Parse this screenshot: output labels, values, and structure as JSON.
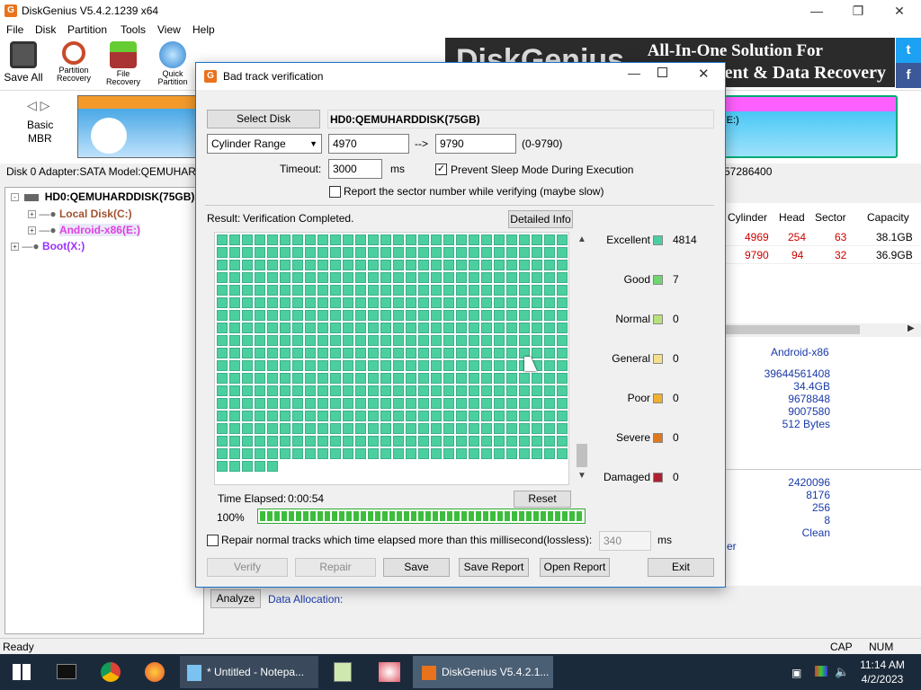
{
  "app": {
    "title": "DiskGenius V5.4.2.1239 x64",
    "menu": [
      "File",
      "Disk",
      "Partition",
      "Tools",
      "View",
      "Help"
    ],
    "toolbar": [
      "Save All",
      "Partition Recovery",
      "File Recovery",
      "Quick Partition"
    ],
    "banner_line1": "All-In-One Solution For",
    "banner_line2": "ement & Data Recovery",
    "banner_logo": "DiskGenius",
    "social": [
      "t",
      "f"
    ]
  },
  "disk_area": {
    "nav": "Basic",
    "nav2": "MBR",
    "right_label1": "(E:)",
    "right_label2": ")",
    "info": "Disk 0 Adapter:SATA  Model:QEMUHARD",
    "info_right": "57286400"
  },
  "tree": {
    "disk": "HD0:QEMUHARDDISK(75GB)",
    "items": [
      {
        "label": "Local Disk(C:)",
        "color": "#8b4513"
      },
      {
        "label": "Android-x86(E:)",
        "color": "#e040e0"
      },
      {
        "label": "Boot(X:)",
        "color": "#9b30ff"
      }
    ]
  },
  "ptable": {
    "headers": [
      "Cylinder",
      "Head",
      "Sector",
      "Capacity"
    ],
    "rows": [
      [
        "4969",
        "254",
        "63",
        "38.1GB"
      ],
      [
        "9790",
        "94",
        "32",
        "36.9GB"
      ]
    ]
  },
  "pinfo": {
    "name": "Android-x86",
    "values1": [
      "39644561408",
      "34.4GB",
      "9678848",
      "9007580",
      "512 Bytes"
    ],
    "values2": [
      "2420096",
      "8176",
      "256",
      "8",
      "Clean"
    ],
    "frag": "er"
  },
  "bottom": {
    "analyze": "Analyze",
    "data_allocation": "Data Allocation:"
  },
  "status": {
    "ready": "Ready",
    "cap": "CAP",
    "num": "NUM"
  },
  "dialog": {
    "title": "Bad track verification",
    "select_disk": "Select Disk",
    "disk_name": "HD0:QEMUHARDDISK(75GB)",
    "range_mode": "Cylinder Range",
    "range_from": "4970",
    "arrow": "-->",
    "range_to": "9790",
    "range_hint": "(0-9790)",
    "timeout_label": "Timeout:",
    "timeout_value": "3000",
    "timeout_unit": "ms",
    "prevent_sleep": "Prevent Sleep Mode During Execution",
    "report_sector": "Report the sector number while verifying (maybe slow)",
    "result_label": "Result:",
    "result_value": "Verification Completed.",
    "detailed_info": "Detailed Info",
    "legend": [
      {
        "label": "Excellent",
        "color": "#4ccf9f",
        "count": "4814"
      },
      {
        "label": "Good",
        "color": "#6fd66f",
        "count": "7"
      },
      {
        "label": "Normal",
        "color": "#b9e07a",
        "count": "0"
      },
      {
        "label": "General",
        "color": "#f4e08a",
        "count": "0"
      },
      {
        "label": "Poor",
        "color": "#f0b030",
        "count": "0"
      },
      {
        "label": "Severe",
        "color": "#e07820",
        "count": "0"
      },
      {
        "label": "Damaged",
        "color": "#b02030",
        "count": "0"
      }
    ],
    "time_elapsed_label": "Time Elapsed:",
    "time_elapsed_value": "0:00:54",
    "reset": "Reset",
    "progress_text": "100%",
    "progress": 1.0,
    "repair_label": "Repair normal tracks which time elapsed more than this millisecond(lossless):",
    "repair_value": "340",
    "repair_unit": "ms",
    "buttons": {
      "verify": "Verify",
      "repair": "Repair",
      "save": "Save",
      "save_report": "Save Report",
      "open_report": "Open Report",
      "exit": "Exit"
    }
  },
  "taskbar": {
    "notepad": "* Untitled - Notepa...",
    "diskgenius": "DiskGenius V5.4.2.1...",
    "time": "11:14 AM",
    "date": "4/2/2023"
  }
}
